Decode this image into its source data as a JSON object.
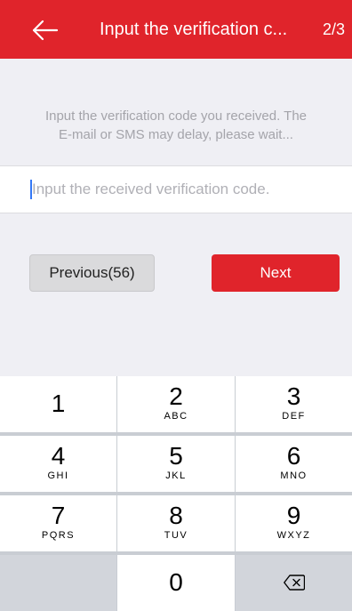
{
  "header": {
    "title": "Input the verification c...",
    "step": "2/3",
    "back_icon": "arrow-left-icon",
    "color": "#e0242b"
  },
  "hint": {
    "line1": "Input the verification code you received. The",
    "line2": "E-mail or SMS may delay, please wait..."
  },
  "code_input": {
    "placeholder": "Input the received verification code.",
    "value": ""
  },
  "buttons": {
    "previous_label": "Previous(56)",
    "next_label": "Next"
  },
  "keypad": {
    "keys": [
      {
        "digit": "1",
        "letters": ""
      },
      {
        "digit": "2",
        "letters": "ABC"
      },
      {
        "digit": "3",
        "letters": "DEF"
      },
      {
        "digit": "4",
        "letters": "GHI"
      },
      {
        "digit": "5",
        "letters": "JKL"
      },
      {
        "digit": "6",
        "letters": "MNO"
      },
      {
        "digit": "7",
        "letters": "PQRS"
      },
      {
        "digit": "8",
        "letters": "TUV"
      },
      {
        "digit": "9",
        "letters": "WXYZ"
      },
      {
        "digit": "0",
        "letters": ""
      }
    ],
    "delete_icon": "backspace-icon"
  }
}
